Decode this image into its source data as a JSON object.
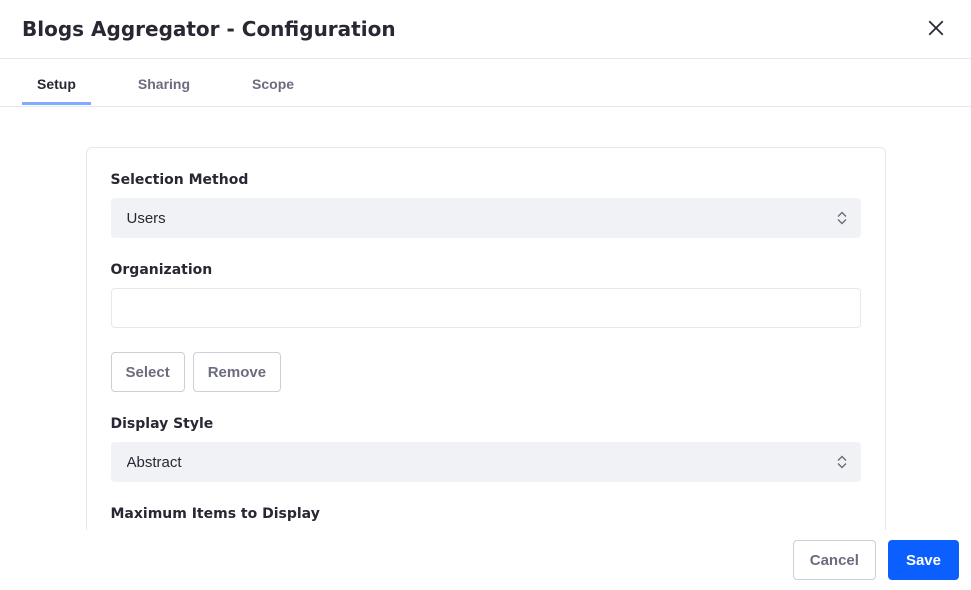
{
  "header": {
    "title": "Blogs Aggregator - Configuration"
  },
  "tabs": [
    {
      "label": "Setup"
    },
    {
      "label": "Sharing"
    },
    {
      "label": "Scope"
    }
  ],
  "form": {
    "selection_method": {
      "label": "Selection Method",
      "value": "Users"
    },
    "organization": {
      "label": "Organization",
      "value": ""
    },
    "buttons": {
      "select": "Select",
      "remove": "Remove"
    },
    "display_style": {
      "label": "Display Style",
      "value": "Abstract"
    },
    "max_items": {
      "label": "Maximum Items to Display"
    }
  },
  "footer": {
    "cancel": "Cancel",
    "save": "Save"
  }
}
